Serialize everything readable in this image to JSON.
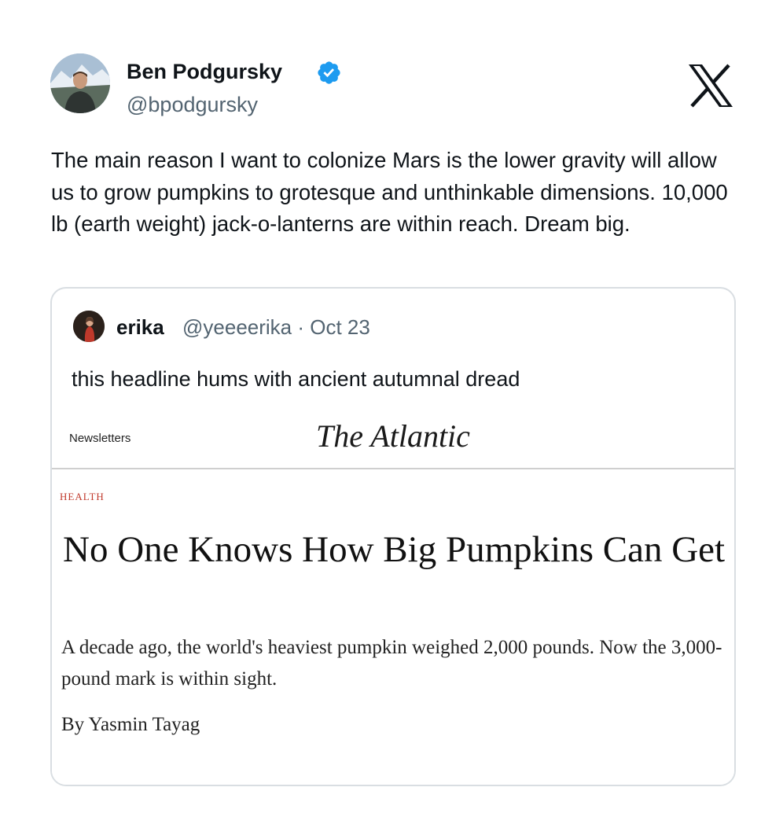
{
  "tweet": {
    "author_name": "Ben Podgursky",
    "author_handle": "@bpodgursky",
    "verified": true,
    "text": "The main reason I want to colonize Mars is the lower gravity will allow us to grow pumpkins to grotesque and unthinkable dimensions. 10,000 lb (earth weight) jack-o-lanterns are within reach. Dream big.",
    "platform_icon": "x-logo-icon",
    "verified_color": "#1d9bf0"
  },
  "quote": {
    "author_name": "erika",
    "author_handle": "@yeeeerika · Oct 23",
    "text": "this headline hums with ancient autumnal dread",
    "article": {
      "nav_label": "Newsletters",
      "masthead": "The Atlantic",
      "section": "HEALTH",
      "headline": "No One Knows How Big Pumpkins Can Get",
      "dek": "A decade ago, the world's heaviest pumpkin weighed 2,000 pounds. Now the 3,000-pound mark is within sight.",
      "byline": "By Yasmin Tayag",
      "section_color": "#c0392b"
    }
  }
}
